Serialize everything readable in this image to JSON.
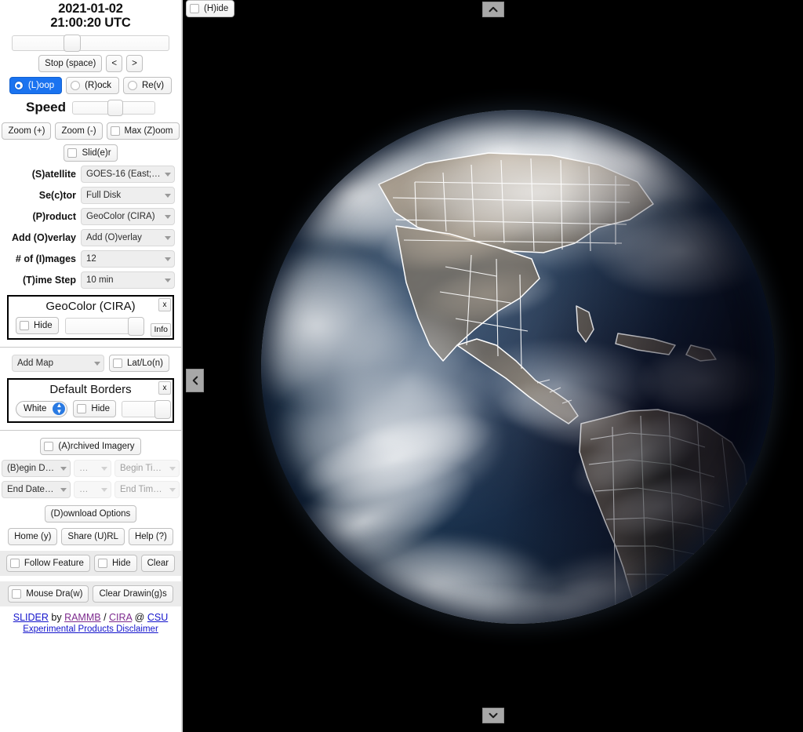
{
  "header": {
    "date": "2021-01-02",
    "time": "21:00:20 UTC"
  },
  "playback": {
    "frame_slider_percent": 37,
    "stop_label": "Stop (space)",
    "prev_label": "<",
    "next_label": ">",
    "modes": [
      {
        "label": "(L)oop",
        "selected": true
      },
      {
        "label": "(R)ock",
        "selected": false
      },
      {
        "label": "Re(v)",
        "selected": false
      }
    ],
    "speed_label": "Speed",
    "speed_slider_percent": 52
  },
  "zoom_controls": {
    "zoom_in_label": "Zoom (+)",
    "zoom_out_label": "Zoom (-)",
    "max_zoom_label": "Max (Z)oom",
    "slider_label": "Slid(e)r"
  },
  "fields": [
    {
      "label": "(S)atellite",
      "value": "GOES-16 (East;…)"
    },
    {
      "label": "Se(c)tor",
      "value": "Full Disk"
    },
    {
      "label": "(P)roduct",
      "value": "GeoColor (CIRA)"
    },
    {
      "label": "Add (O)verlay",
      "value": "Add (O)verlay"
    },
    {
      "label": "# of (I)mages",
      "value": "12"
    },
    {
      "label": "(T)ime Step",
      "value": "10 min"
    }
  ],
  "product_panel": {
    "title": "GeoColor (CIRA)",
    "hide_label": "Hide",
    "close_label": "x",
    "info_label": "Info",
    "opacity_percent": 100
  },
  "map_row": {
    "add_map_label": "Add Map",
    "latlon_label": "Lat/Lo(n)"
  },
  "borders_panel": {
    "title": "Default Borders",
    "color_value": "White",
    "hide_label": "Hide",
    "close_label": "x",
    "opacity_percent": 100
  },
  "archive": {
    "archived_label": "(A)rchived Imagery",
    "begin_date": "(B)egin D…",
    "begin_mid": "…",
    "begin_time": "Begin Ti…",
    "end_date": "End Date…",
    "end_mid": "…",
    "end_time": "End Tim…"
  },
  "actions": {
    "download_label": "(D)ownload Options",
    "home_label": "Home (y)",
    "share_label": "Share (U)RL",
    "help_label": "Help (?)",
    "follow_feature_label": "Follow Feature",
    "follow_hide_label": "Hide",
    "follow_clear_label": "Clear",
    "mouse_draw_label": "Mouse Dra(w)",
    "clear_drawings_label": "Clear Drawin(g)s"
  },
  "credits": {
    "slider": "SLIDER",
    "by": " by ",
    "rammb": "RAMMB",
    "slash": " / ",
    "cira": "CIRA",
    "at": " @ ",
    "csu": "CSU",
    "disclaimer": "Experimental Products Disclaimer",
    "link_color": "#1414cc",
    "visited_color": "#7d2a8e"
  },
  "viewer": {
    "hide_label": "(H)ide",
    "background_color": "#000000"
  }
}
